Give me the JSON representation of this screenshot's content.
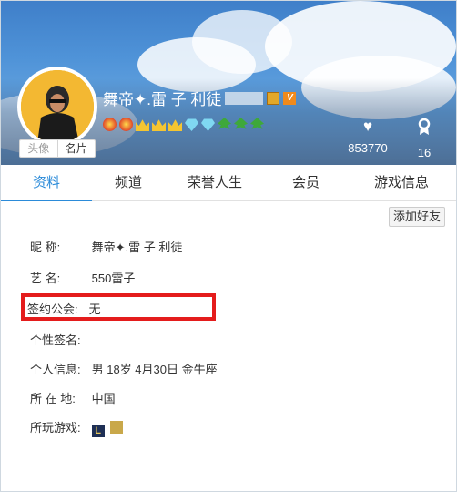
{
  "profile": {
    "name": "舞帝✦.雷 子   利徒",
    "avatar_tab": "头像",
    "card_tab": "名片",
    "likes_count": "853770",
    "honor_count": "16"
  },
  "badges": [
    "sun",
    "sun",
    "crown",
    "crown",
    "crown",
    "gem",
    "gem",
    "leaf",
    "leaf",
    "leaf"
  ],
  "tabs": [
    "资料",
    "频道",
    "荣誉人生",
    "会员",
    "游戏信息"
  ],
  "add_friend_label": "添加好友",
  "info": {
    "nickname_label": "昵      称:",
    "nickname_value": "舞帝✦.雷 子   利徒",
    "stage_label": "艺      名:",
    "stage_value": "550雷子",
    "guild_label": "签约公会:",
    "guild_value": "无",
    "signature_label": "个性签名:",
    "personal_label": "个人信息:",
    "personal_value": "男    18岁    4月30日    金牛座",
    "location_label": "所 在 地:",
    "location_value": "中国",
    "games_label": "所玩游戏:",
    "games_icon_text": "L"
  },
  "colors": {
    "accent": "#2b8bd9",
    "highlight": "#e41c1c"
  },
  "icons": [
    "heart-icon",
    "award-icon",
    "vip-badge-icon",
    "v-level-icon"
  ]
}
